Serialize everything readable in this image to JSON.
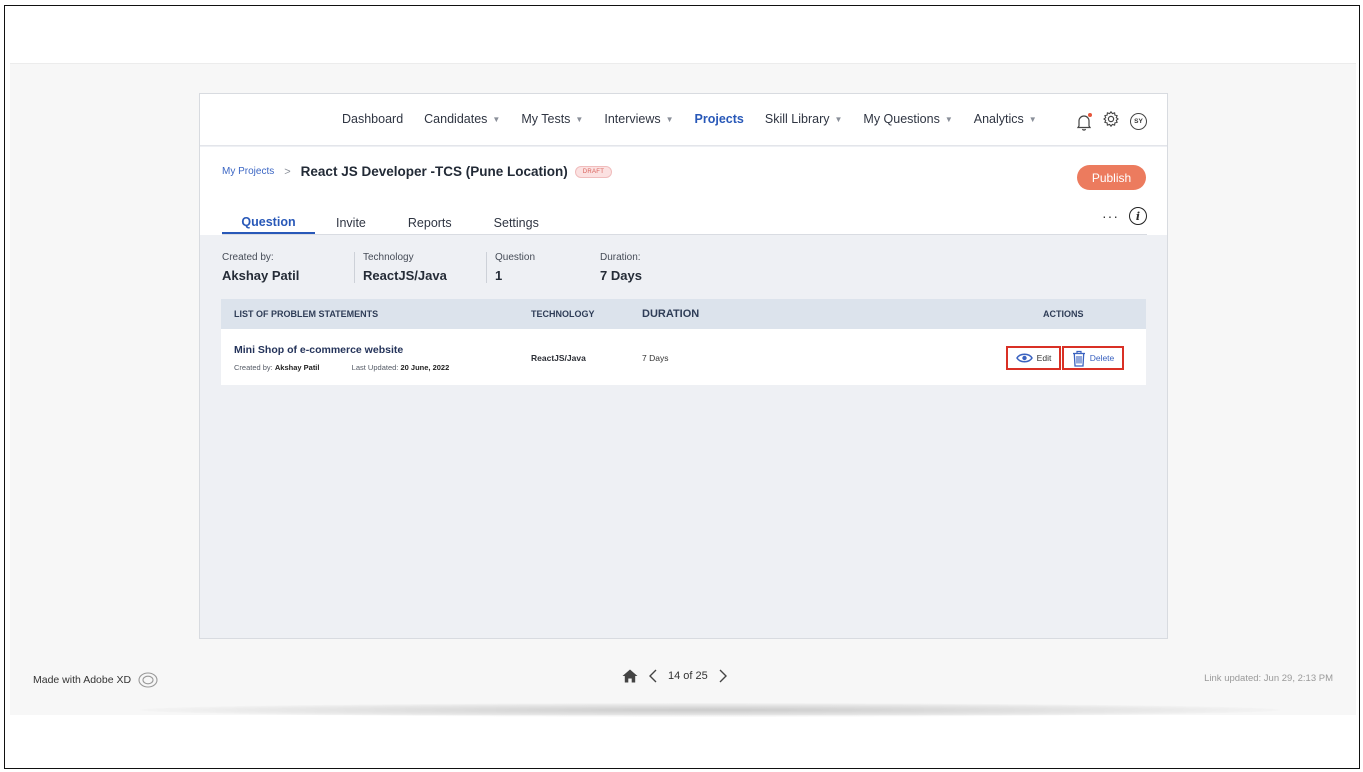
{
  "nav": {
    "items": [
      {
        "label": "Dashboard",
        "dropdown": false,
        "active": false
      },
      {
        "label": "Candidates",
        "dropdown": true,
        "active": false
      },
      {
        "label": "My Tests",
        "dropdown": true,
        "active": false
      },
      {
        "label": "Interviews",
        "dropdown": true,
        "active": false
      },
      {
        "label": "Projects",
        "dropdown": false,
        "active": true
      },
      {
        "label": "Skill Library",
        "dropdown": true,
        "active": false
      },
      {
        "label": "My Questions",
        "dropdown": true,
        "active": false
      },
      {
        "label": "Analytics",
        "dropdown": true,
        "active": false
      }
    ],
    "avatar_initials": "SY"
  },
  "breadcrumb": {
    "parent": "My Projects",
    "separator": ">",
    "title": "React JS  Developer -TCS (Pune Location)",
    "badge": "DRAFT"
  },
  "publish_label": "Publish",
  "tabs": [
    "Question",
    "Invite",
    "Reports",
    "Settings"
  ],
  "tab_more": "···",
  "meta": {
    "created_by_label": "Created by:",
    "created_by_value": "Akshay Patil",
    "technology_label": "Technology",
    "technology_value": "ReactJS/Java",
    "question_label": "Question",
    "question_value": "1",
    "duration_label": "Duration:",
    "duration_value": "7 Days"
  },
  "table": {
    "headers": {
      "list": "LIST OF PROBLEM STATEMENTS",
      "technology": "TECHNOLOGY",
      "duration": "DURATION",
      "actions": "ACTIONS"
    },
    "rows": [
      {
        "title": "Mini Shop of e-commerce website",
        "created_by_label": "Created by:",
        "created_by": "Akshay Patil",
        "updated_label": "Last Updated:",
        "updated": "20 June, 2022",
        "technology": "ReactJS/Java",
        "duration": "7 Days",
        "edit_label": "Edit",
        "delete_label": "Delete"
      }
    ]
  },
  "xd": {
    "made_with": "Made with Adobe XD",
    "page": "14 of 25",
    "link_updated": "Link updated: Jun 29, 2:13 PM"
  },
  "colors": {
    "accent": "#2858b8",
    "publish": "#ec7b5e",
    "highlight": "#d93025"
  }
}
